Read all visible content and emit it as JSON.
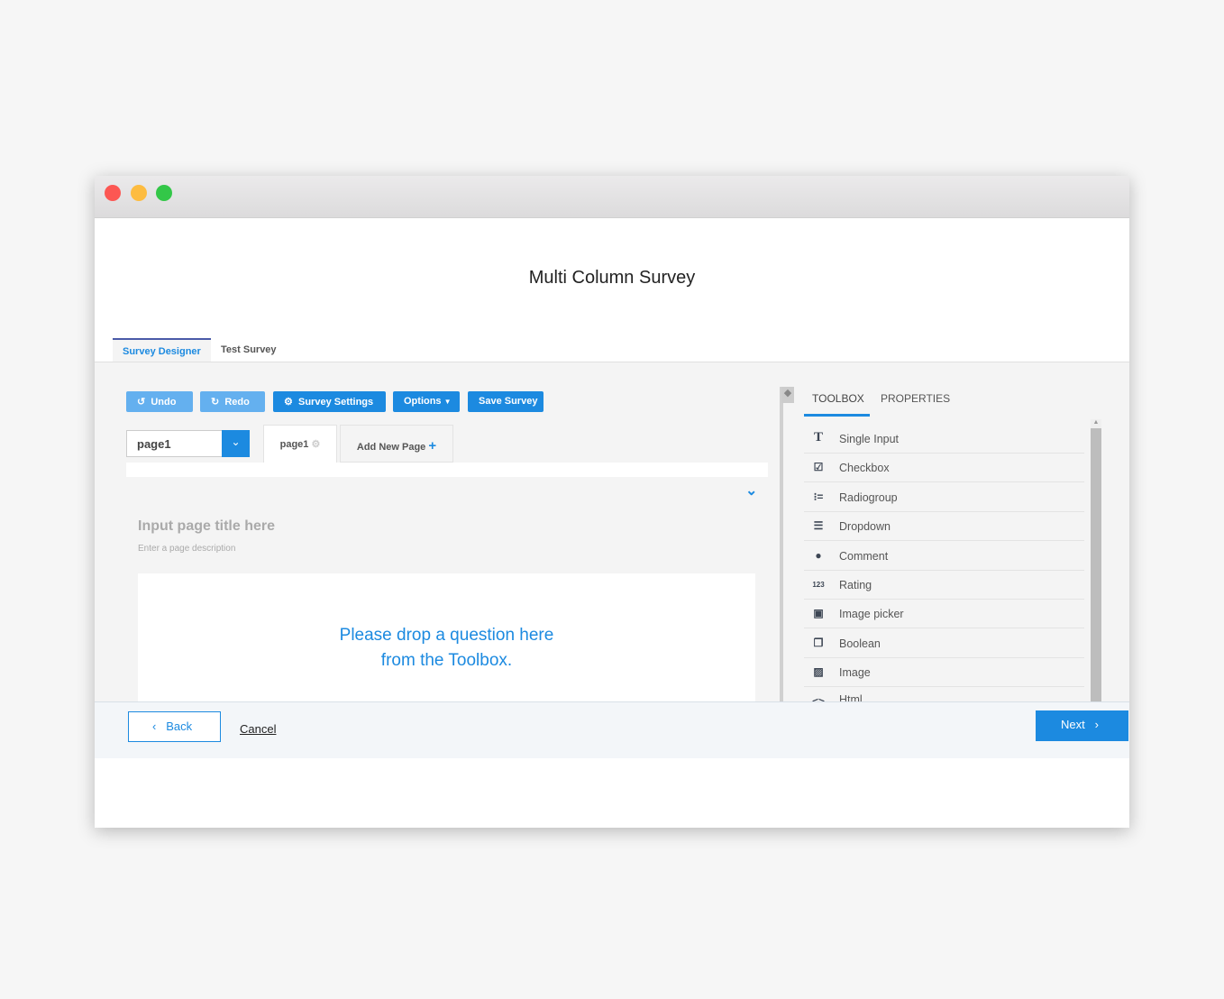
{
  "window": {
    "title": "Multi Column Survey",
    "controls": [
      "close",
      "minimize",
      "maximize"
    ]
  },
  "tabs": [
    {
      "label": "Survey Designer",
      "active": true
    },
    {
      "label": "Test Survey",
      "active": false
    }
  ],
  "toolbar": {
    "undo": "Undo",
    "redo": "Redo",
    "settings": "Survey Settings",
    "options": "Options",
    "save": "Save Survey"
  },
  "page_selector": {
    "value": "page1"
  },
  "page_tabs": {
    "current": "page1",
    "add": "Add New Page"
  },
  "page": {
    "title_placeholder": "Input page title here",
    "description_placeholder": "Enter a page description",
    "drop_line1": "Please drop a question here",
    "drop_line2": "from the Toolbox."
  },
  "sidebar": {
    "tabs": [
      "TOOLBOX",
      "PROPERTIES"
    ],
    "active_tab": "TOOLBOX",
    "items": [
      {
        "label": "Single Input",
        "icon": "text-icon"
      },
      {
        "label": "Checkbox",
        "icon": "checkbox-icon"
      },
      {
        "label": "Radiogroup",
        "icon": "radiogroup-icon"
      },
      {
        "label": "Dropdown",
        "icon": "dropdown-icon"
      },
      {
        "label": "Comment",
        "icon": "comment-icon"
      },
      {
        "label": "Rating",
        "icon": "rating-icon"
      },
      {
        "label": "Image picker",
        "icon": "image-picker-icon"
      },
      {
        "label": "Boolean",
        "icon": "boolean-icon"
      },
      {
        "label": "Image",
        "icon": "image-icon"
      },
      {
        "label": "Html",
        "icon": "html-icon"
      }
    ]
  },
  "footer": {
    "back": "Back",
    "cancel": "Cancel",
    "next": "Next"
  },
  "colors": {
    "accent": "#1c8ae0",
    "close": "#fc5753",
    "minimize": "#fdbc40",
    "maximize": "#33c748"
  }
}
